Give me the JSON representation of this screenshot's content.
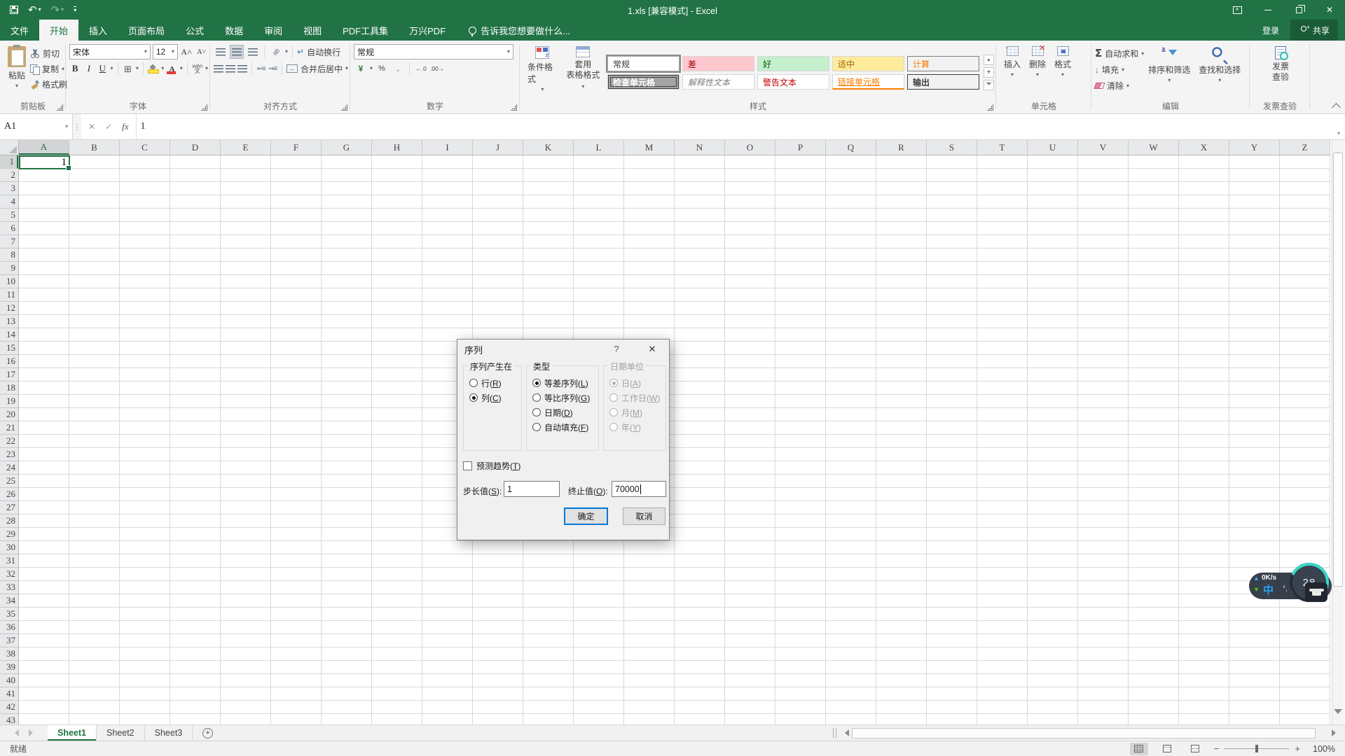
{
  "titlebar": {
    "title": "1.xls [兼容模式] - Excel"
  },
  "tabs": {
    "file": "文件",
    "items": [
      "开始",
      "插入",
      "页面布局",
      "公式",
      "数据",
      "审阅",
      "视图",
      "PDF工具集",
      "万兴PDF"
    ],
    "active": "开始",
    "tellme": "告诉我您想要做什么...",
    "sign_in": "登录",
    "share": "共享"
  },
  "ribbon": {
    "clipboard": {
      "label": "剪贴板",
      "paste": "粘贴",
      "cut": "剪切",
      "copy": "复制",
      "painter": "格式刷"
    },
    "font": {
      "label": "字体",
      "name": "宋体",
      "size": "12"
    },
    "alignment": {
      "label": "对齐方式",
      "wrap": "自动换行",
      "merge": "合并后居中"
    },
    "number": {
      "label": "数字",
      "format": "常规"
    },
    "styles": {
      "label": "样式",
      "conditional": "条件格式",
      "table_l1": "套用",
      "table_l2": "表格格式",
      "gallery": [
        {
          "name": "常规",
          "cls": "",
          "selected": true
        },
        {
          "name": "差",
          "cls": "s-bad"
        },
        {
          "name": "好",
          "cls": "s-good"
        },
        {
          "name": "适中",
          "cls": "s-neutral"
        },
        {
          "name": "计算",
          "cls": "s-calc"
        },
        {
          "name": "检查单元格",
          "cls": "s-check"
        },
        {
          "name": "解释性文本",
          "cls": "s-explain"
        },
        {
          "name": "警告文本",
          "cls": "s-warn"
        },
        {
          "name": "链接单元格",
          "cls": "s-link"
        },
        {
          "name": "输出",
          "cls": "s-output"
        }
      ]
    },
    "cells": {
      "label": "单元格",
      "insert": "插入",
      "delete": "删除",
      "format": "格式"
    },
    "editing": {
      "label": "编辑",
      "autosum": "自动求和",
      "fill": "填充",
      "clear": "清除",
      "sort": "排序和筛选",
      "find": "查找和选择"
    },
    "invoice": {
      "label": "发票查验",
      "btn_l1": "发票",
      "btn_l2": "查验"
    }
  },
  "formula_bar": {
    "name_box": "A1",
    "value": "1"
  },
  "grid": {
    "columns": [
      "A",
      "B",
      "C",
      "D",
      "E",
      "F",
      "G",
      "H",
      "I",
      "J",
      "K",
      "L",
      "M",
      "N",
      "O",
      "P",
      "Q",
      "R",
      "S",
      "T",
      "U",
      "V",
      "W",
      "X",
      "Y",
      "Z"
    ],
    "row_count": 43,
    "selected": {
      "col": "A",
      "row": 1,
      "value": "1"
    }
  },
  "dialog": {
    "title": "序列",
    "groups": {
      "produce_in": {
        "label": "序列产生在",
        "options": [
          {
            "text": "行",
            "key": "R",
            "checked": false
          },
          {
            "text": "列",
            "key": "C",
            "checked": true
          }
        ]
      },
      "type": {
        "label": "类型",
        "options": [
          {
            "text": "等差序列",
            "key": "L",
            "checked": true
          },
          {
            "text": "等比序列",
            "key": "G",
            "checked": false
          },
          {
            "text": "日期",
            "key": "D",
            "checked": false
          },
          {
            "text": "自动填充",
            "key": "F",
            "checked": false
          }
        ]
      },
      "date_unit": {
        "label": "日期单位",
        "disabled": true,
        "options": [
          {
            "text": "日",
            "key": "A",
            "checked": true
          },
          {
            "text": "工作日",
            "key": "W",
            "checked": false
          },
          {
            "text": "月",
            "key": "M",
            "checked": false
          },
          {
            "text": "年",
            "key": "Y",
            "checked": false
          }
        ]
      }
    },
    "trend": {
      "text": "预测趋势",
      "key": "T"
    },
    "step": {
      "text": "步长值",
      "key": "S",
      "value": "1"
    },
    "stop": {
      "text": "终止值",
      "key": "O",
      "value": "70000"
    },
    "ok": "确定",
    "cancel": "取消"
  },
  "sheet_bar": {
    "sheets": [
      "Sheet1",
      "Sheet2",
      "Sheet3"
    ],
    "active": "Sheet1"
  },
  "status_bar": {
    "ready": "就绪",
    "zoom": "100%"
  },
  "widget": {
    "up_speed": "0K/s",
    "logo": "中",
    "deg": "°,",
    "half": "半",
    "gauge_value": "28"
  },
  "colors": {
    "accent": "#217346",
    "bad_bg": "#ffc7ce",
    "good_bg": "#c6efce",
    "neutral_bg": "#ffeb9c"
  }
}
